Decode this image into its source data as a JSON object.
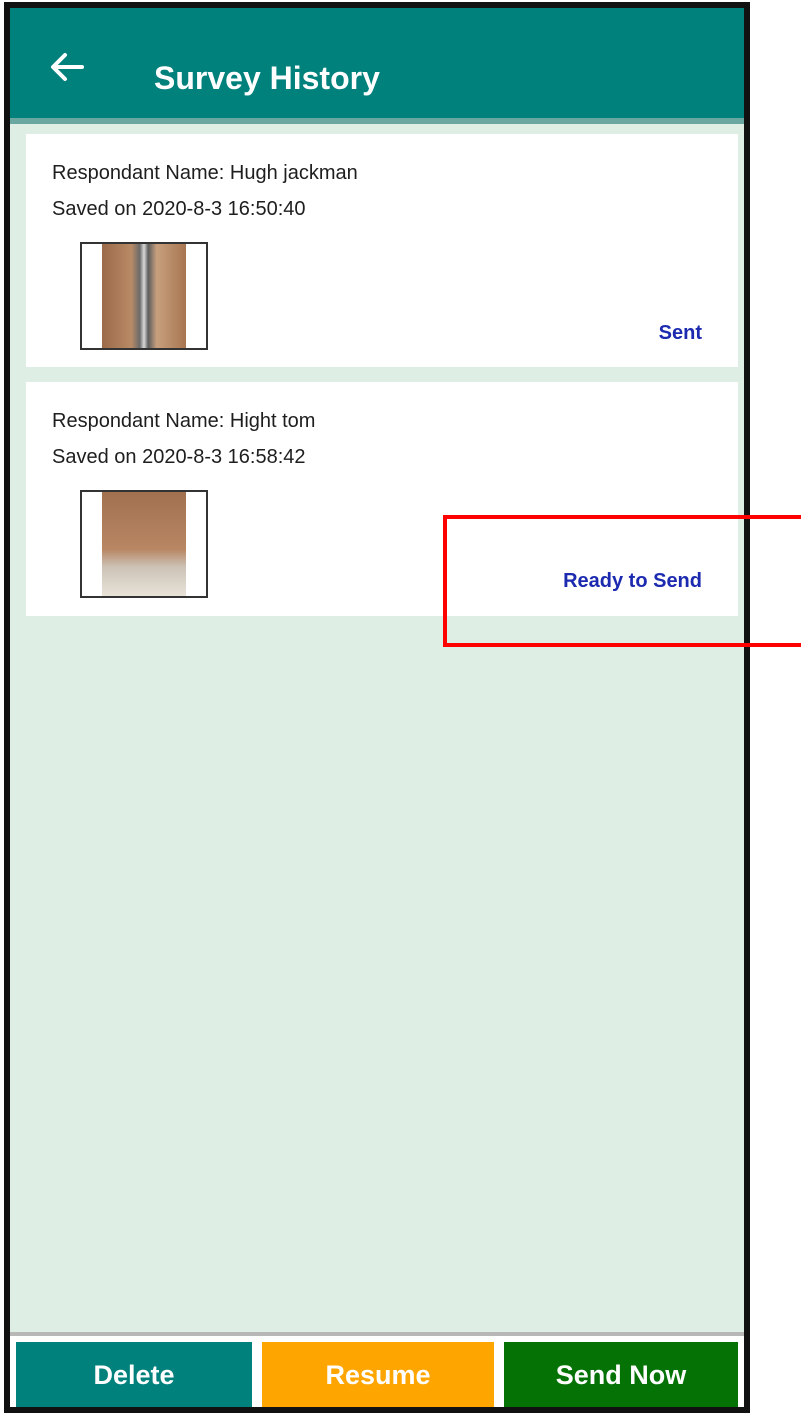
{
  "appbar": {
    "back_icon": "arrow-left-icon",
    "title": "Survey History",
    "color": "#00817c"
  },
  "surveys": [
    {
      "respondent": "Respondant Name: Hugh jackman",
      "saved": "Saved on 2020-8-3 16:50:40",
      "status": "Sent"
    },
    {
      "respondent": "Respondant Name: Hight tom",
      "saved": "Saved on 2020-8-3 16:58:42",
      "status": "Ready to Send"
    }
  ],
  "actions": {
    "delete_label": "Delete",
    "resume_label": "Resume",
    "send_now_label": "Send Now",
    "delete_color": "#00817c",
    "resume_color": "#ffa500",
    "send_now_color": "#047204"
  },
  "status_color": "#1c2ab0",
  "annotation_color": "#ff0000"
}
